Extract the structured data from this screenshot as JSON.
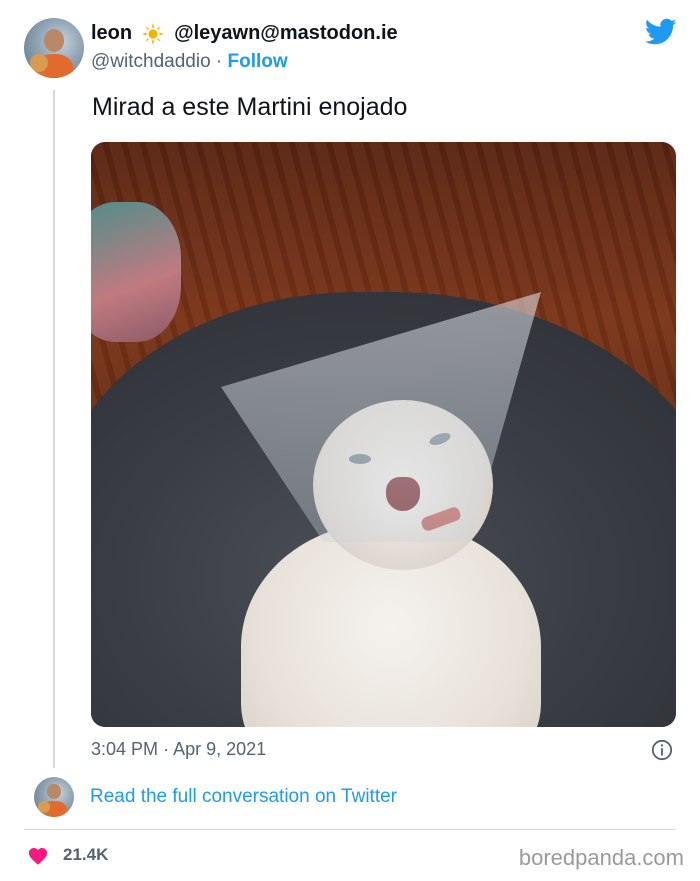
{
  "tweet": {
    "display_name": "leon",
    "title_handle": "@leyawn@mastodon.ie",
    "handle": "@witchdaddio",
    "separator": "·",
    "follow_label": "Follow",
    "text": "Mirad a este Martini enojado",
    "time": "3:04 PM",
    "date": "Apr 9, 2021",
    "conversation_link": "Read the full conversation on Twitter",
    "likes": "21.4K"
  },
  "watermark": "boredpanda.com",
  "icons": {
    "badge": "sun-icon",
    "brand": "twitter-bird-icon",
    "info": "info-icon",
    "like": "heart-icon"
  },
  "colors": {
    "accent": "#1d9bf0",
    "like": "#f91880",
    "secondary_text": "#536471",
    "thread_line": "#cfd9de"
  }
}
